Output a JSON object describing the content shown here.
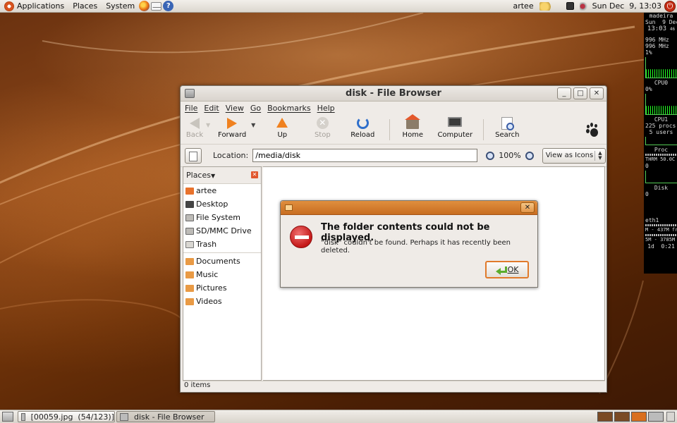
{
  "top_panel": {
    "menus": [
      "Applications",
      "Places",
      "System"
    ],
    "user": "artee",
    "clock": "Sun Dec  9, 13:03"
  },
  "conky": {
    "host": "madeira",
    "date": "Sun  9 Dec",
    "time": "13:03",
    "seconds": "46",
    "freq1": "996 MHz",
    "freq2": "996 MHz",
    "cpu0_pct": "1%",
    "cpu0_label": "CPU0",
    "cpu1_pct": "0%",
    "cpu1_label": "CPU1",
    "procs": "225 procs",
    "users": "5 users",
    "proc_label": "Proc",
    "thrm": "THRM 50.0C",
    "disk_zero1": "0",
    "disk_zero2": "0",
    "disk_label": "Disk",
    "net_label": "eth1",
    "mem": "M - 437M fr",
    "swap": "5M - 3785M",
    "uptime": "1d  0:21"
  },
  "window": {
    "title": "disk - File Browser",
    "menus": [
      "File",
      "Edit",
      "View",
      "Go",
      "Bookmarks",
      "Help"
    ],
    "toolbar": {
      "back": "Back",
      "forward": "Forward",
      "up": "Up",
      "stop": "Stop",
      "reload": "Reload",
      "home": "Home",
      "computer": "Computer",
      "search": "Search"
    },
    "location_label": "Location:",
    "location_value": "/media/disk",
    "zoom": "100%",
    "view_as": "View as Icons",
    "places_header": "Places",
    "places": [
      "artee",
      "Desktop",
      "File System",
      "SD/MMC Drive",
      "Trash"
    ],
    "bookmarks": [
      "Documents",
      "Music",
      "Pictures",
      "Videos"
    ],
    "status": "0 items"
  },
  "dialog": {
    "heading": "The folder contents could not be displayed.",
    "message": "\"disk\" couldn't be found. Perhaps it has recently been deleted.",
    "ok": "OK"
  },
  "bottom_panel": {
    "tasks": [
      "[00059.jpg  (54/123)]",
      "disk - File Browser"
    ]
  }
}
